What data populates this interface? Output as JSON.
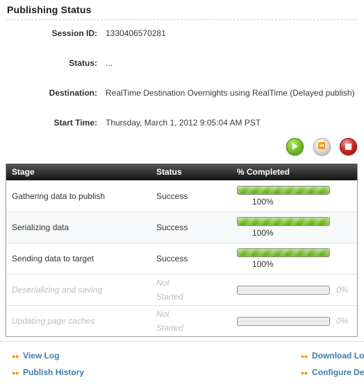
{
  "page_title": "Publishing Status",
  "details": [
    {
      "label": "Session ID:",
      "value": "1330406570281"
    },
    {
      "label": "Status:",
      "value": "..."
    },
    {
      "label": "Destination:",
      "value": "RealTime Destination Overnights using RealTime (Delayed publish)"
    },
    {
      "label": "Start Time:",
      "value": "Thursday, March 1, 2012 9:05:04 AM PST"
    }
  ],
  "controls": {
    "play": {
      "name": "start-button",
      "glyph": "▶"
    },
    "rewind": {
      "name": "rewind-button",
      "glyph": "⏪"
    },
    "stop": {
      "name": "stop-button",
      "glyph": "■"
    }
  },
  "table": {
    "headers": {
      "stage": "Stage",
      "status": "Status",
      "percent": "% Completed"
    },
    "rows": [
      {
        "stage": "Gathering data to publish",
        "status": "Success",
        "status_w1": "Success",
        "status_w2": "",
        "percent": 100,
        "percent_label": "100%",
        "state": "done"
      },
      {
        "stage": "Serializing data",
        "status": "Success",
        "status_w1": "Success",
        "status_w2": "",
        "percent": 100,
        "percent_label": "100%",
        "state": "done"
      },
      {
        "stage": "Sending data to target",
        "status": "Success",
        "status_w1": "Success",
        "status_w2": "",
        "percent": 100,
        "percent_label": "100%",
        "state": "done"
      },
      {
        "stage": "Deserializing and saving",
        "status": "Not Started",
        "status_w1": "Not",
        "status_w2": "Started",
        "percent": 0,
        "percent_label": "0%",
        "state": "not-started"
      },
      {
        "stage": "Updating page caches",
        "status": "Not Started",
        "status_w1": "Not",
        "status_w2": "Started",
        "percent": 0,
        "percent_label": "0%",
        "state": "not-started"
      }
    ]
  },
  "footer_links": [
    {
      "label": "View Log",
      "name": "view-log-link"
    },
    {
      "label": "Download Log",
      "name": "download-log-link"
    },
    {
      "label": "Publish History",
      "name": "publish-history-link"
    },
    {
      "label": "Configure Destination",
      "name": "configure-destination-link"
    }
  ],
  "colors": {
    "progress_green": "#76bd29",
    "link_blue": "#3d7ca8",
    "chevron_orange": "#f59200",
    "header_dark": "#141415"
  }
}
